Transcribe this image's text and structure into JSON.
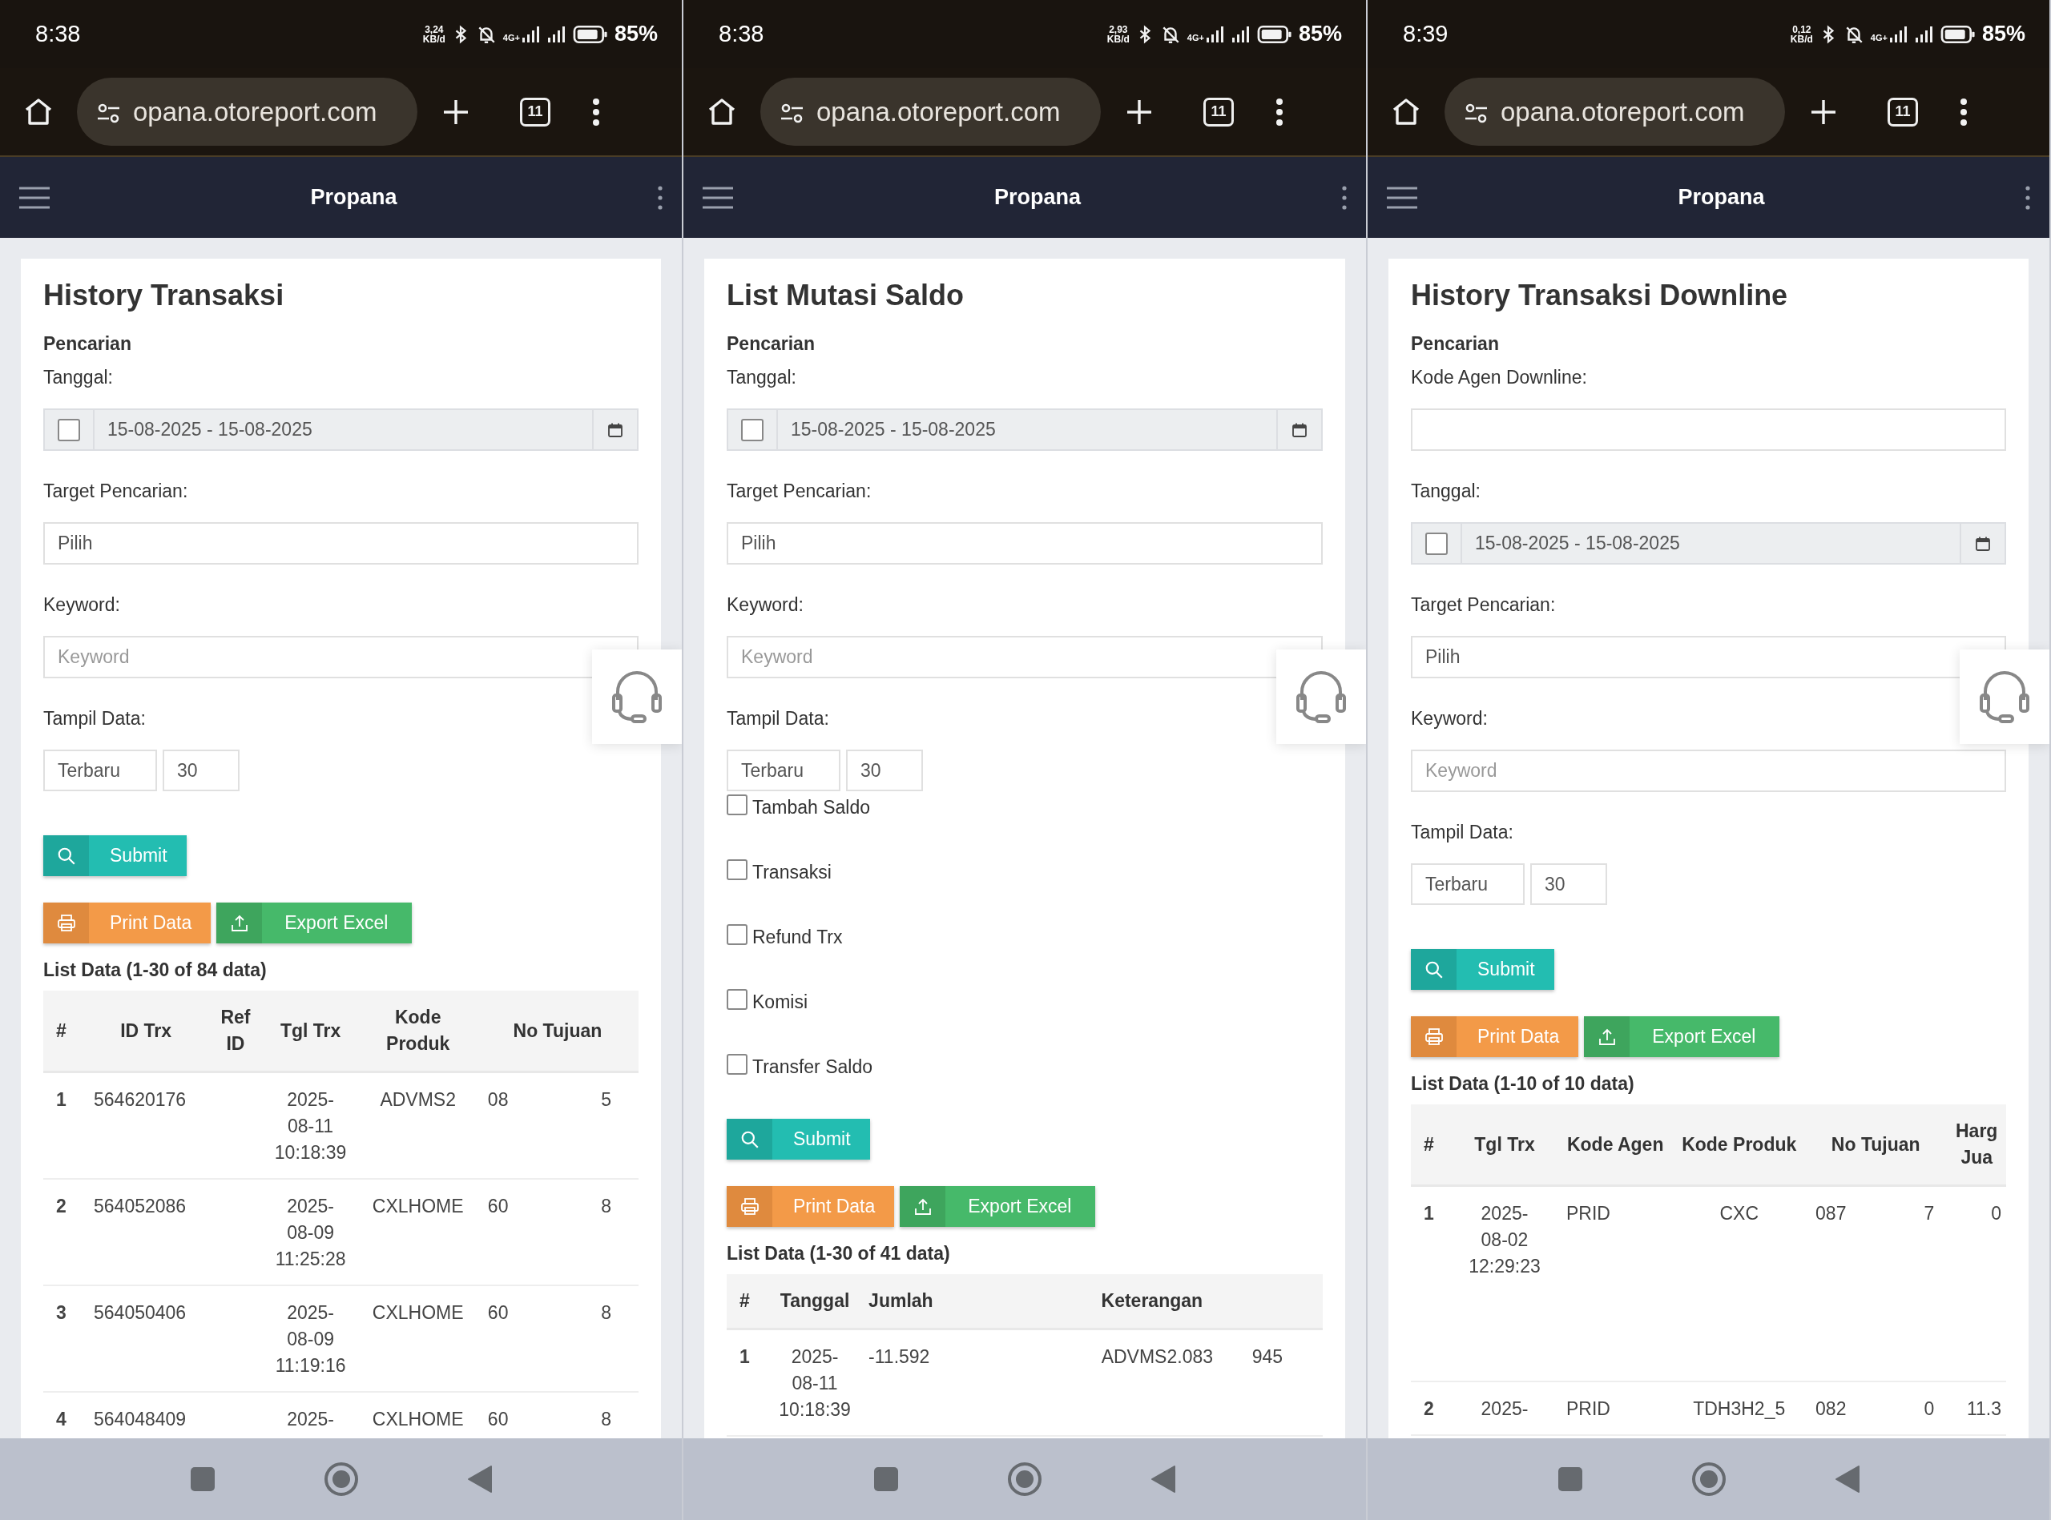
{
  "panels": [
    {
      "status_bar": {
        "time": "8:38",
        "net_speed": "3,24",
        "net_unit": "KB/d",
        "network": "4G+",
        "battery": "85%"
      },
      "browser": {
        "url": "opana.otoreport.com",
        "tab_count": "11"
      },
      "app_bar": {
        "title": "Propana"
      },
      "page": {
        "title": "History Transaksi",
        "section": "Pencarian",
        "fields": [
          {
            "kind": "daterange",
            "label": "Tanggal:",
            "checked": false,
            "value": "15-08-2025 - 15-08-2025"
          },
          {
            "kind": "select",
            "label": "Target Pencarian:",
            "value": "Pilih"
          },
          {
            "kind": "text",
            "label": "Keyword:",
            "placeholder": "Keyword"
          },
          {
            "kind": "display",
            "label": "Tampil Data:",
            "order": "Terbaru",
            "count": "30"
          }
        ],
        "buttons": [
          {
            "kind": "submit",
            "label": "Submit"
          },
          {
            "kind": "print",
            "label": "Print Data"
          },
          {
            "kind": "export",
            "label": "Export Excel"
          }
        ],
        "list_caption": "List Data (1-30 of 84 data)",
        "table": {
          "columns": [
            "#",
            "ID Trx",
            "Ref ID",
            "Tgl Trx",
            "Kode Produk",
            "No Tujuan"
          ],
          "rows": [
            [
              "1",
              "564620176",
              "",
              "2025-08-11 10:18:39",
              "ADVMS2",
              [
                "08",
                "5"
              ]
            ],
            [
              "2",
              "564052086",
              "",
              "2025-08-09 11:25:28",
              "CXLHOME",
              [
                "60",
                "8"
              ]
            ],
            [
              "3",
              "564050406",
              "",
              "2025-08-09 11:19:16",
              "CXLHOME",
              [
                "60",
                "8"
              ]
            ],
            [
              "4",
              "564048409",
              "",
              "2025-",
              "CXLHOME",
              [
                "60",
                "8"
              ]
            ]
          ]
        }
      }
    },
    {
      "status_bar": {
        "time": "8:38",
        "net_speed": "2,93",
        "net_unit": "KB/d",
        "network": "4G+",
        "battery": "85%"
      },
      "browser": {
        "url": "opana.otoreport.com",
        "tab_count": "11"
      },
      "app_bar": {
        "title": "Propana"
      },
      "page": {
        "title": "List Mutasi Saldo",
        "section": "Pencarian",
        "fields": [
          {
            "kind": "daterange",
            "label": "Tanggal:",
            "checked": false,
            "value": "15-08-2025 - 15-08-2025"
          },
          {
            "kind": "select",
            "label": "Target Pencarian:",
            "value": "Pilih"
          },
          {
            "kind": "text",
            "label": "Keyword:",
            "placeholder": "Keyword"
          },
          {
            "kind": "display",
            "label": "Tampil Data:",
            "order": "Terbaru",
            "count": "30"
          },
          {
            "kind": "checkbox",
            "label": "Tambah Saldo",
            "checked": false
          },
          {
            "kind": "checkbox",
            "label": "Transaksi",
            "checked": false
          },
          {
            "kind": "checkbox",
            "label": "Refund Trx",
            "checked": false
          },
          {
            "kind": "checkbox",
            "label": "Komisi",
            "checked": false
          },
          {
            "kind": "checkbox",
            "label": "Transfer Saldo",
            "checked": false
          }
        ],
        "buttons": [
          {
            "kind": "submit",
            "label": "Submit"
          },
          {
            "kind": "print",
            "label": "Print Data"
          },
          {
            "kind": "export",
            "label": "Export Excel"
          }
        ],
        "list_caption": "List Data (1-30 of 41 data)",
        "table": {
          "columns": [
            "#",
            "Tanggal",
            "Jumlah",
            "Keterangan"
          ],
          "rows": [
            [
              "1",
              "2025-08-11 10:18:39",
              "-11.592",
              [
                "ADVMS2.083",
                "945"
              ]
            ]
          ]
        }
      }
    },
    {
      "status_bar": {
        "time": "8:39",
        "net_speed": "0,12",
        "net_unit": "KB/d",
        "network": "4G+",
        "battery": "85%"
      },
      "browser": {
        "url": "opana.otoreport.com",
        "tab_count": "11"
      },
      "app_bar": {
        "title": "Propana"
      },
      "page": {
        "title": "History Transaksi Downline",
        "section": "Pencarian",
        "fields": [
          {
            "kind": "text",
            "label": "Kode Agen Downline:"
          },
          {
            "kind": "daterange",
            "label": "Tanggal:",
            "checked": false,
            "value": "15-08-2025 - 15-08-2025"
          },
          {
            "kind": "select",
            "label": "Target Pencarian:",
            "value": "Pilih"
          },
          {
            "kind": "text",
            "label": "Keyword:",
            "placeholder": "Keyword"
          },
          {
            "kind": "display",
            "label": "Tampil Data:",
            "order": "Terbaru",
            "count": "30"
          }
        ],
        "buttons": [
          {
            "kind": "submit",
            "label": "Submit"
          },
          {
            "kind": "print",
            "label": "Print Data"
          },
          {
            "kind": "export",
            "label": "Export Excel"
          }
        ],
        "list_caption": "List Data (1-10 of 10 data)",
        "table": {
          "columns": [
            "#",
            "Tgl Trx",
            "Kode Agen",
            "Kode Produk",
            "No Tujuan",
            "Harg Jua"
          ],
          "rows": [
            [
              "1",
              "2025-08-02 12:29:23",
              "PRID",
              "CXC",
              [
                "087",
                "7"
              ],
              "0"
            ],
            [
              "2",
              "2025-",
              "PRID",
              "TDH3H2_5",
              [
                "082",
                "0"
              ],
              "11.3"
            ]
          ]
        }
      }
    }
  ]
}
